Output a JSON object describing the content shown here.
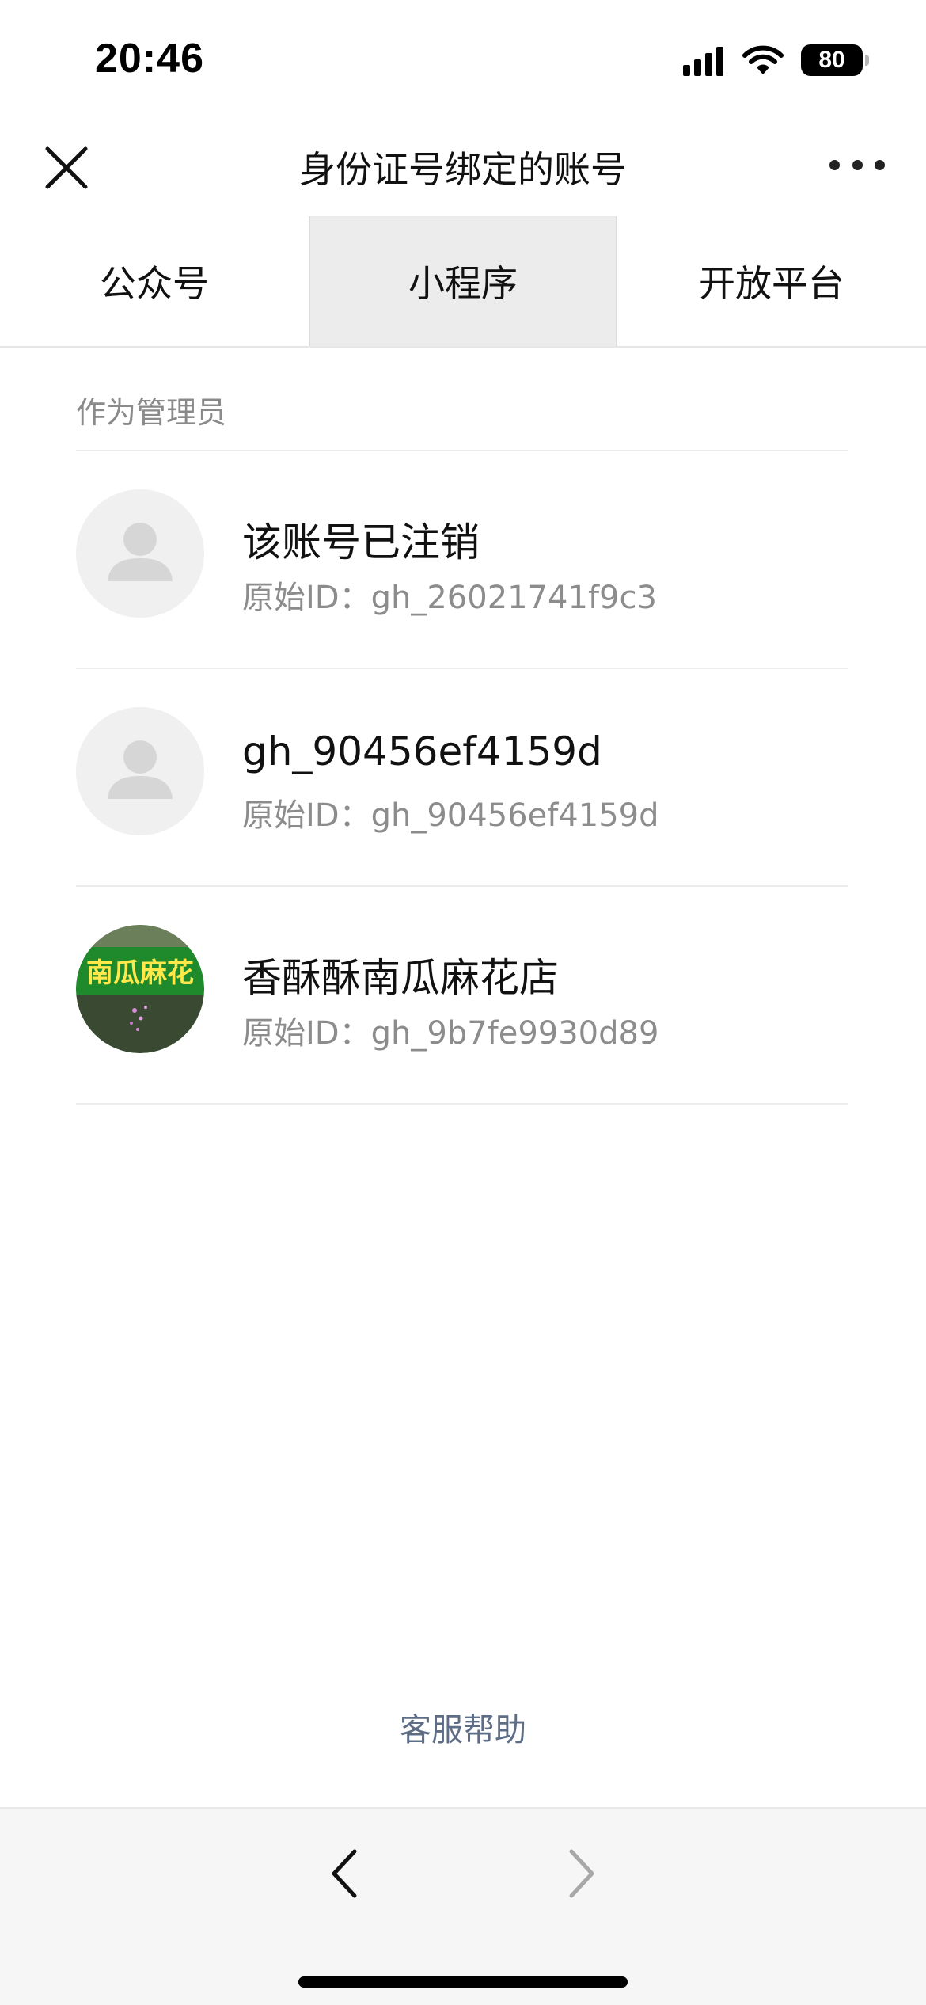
{
  "status_bar": {
    "time": "20:46",
    "battery": "80"
  },
  "header": {
    "title": "身份证号绑定的账号",
    "close_icon": "close-icon",
    "more_icon": "more-icon"
  },
  "tabs": [
    {
      "label": "公众号",
      "active": false
    },
    {
      "label": "小程序",
      "active": true
    },
    {
      "label": "开放平台",
      "active": false
    }
  ],
  "section": {
    "title": "作为管理员"
  },
  "accounts": [
    {
      "name": "该账号已注销",
      "id_label": "原始ID：",
      "id_value": "gh_26021741f9c3",
      "avatar": "default-avatar"
    },
    {
      "name": "gh_90456ef4159d",
      "id_label": "原始ID：",
      "id_value": "gh_90456ef4159d",
      "avatar": "default-avatar"
    },
    {
      "name": "香酥酥南瓜麻花店",
      "id_label": "原始ID：",
      "id_value": "gh_9b7fe9930d89",
      "avatar": "shop-sign-avatar",
      "avatar_text": "南瓜麻花"
    }
  ],
  "footer": {
    "help_link": "客服帮助"
  },
  "colors": {
    "active_tab_bg": "#ececec",
    "link": "#5e6d86",
    "secondary_text": "#8c8c8c",
    "avatar_green": "#1f8a2c",
    "avatar_sign_text": "#ffe84a"
  }
}
